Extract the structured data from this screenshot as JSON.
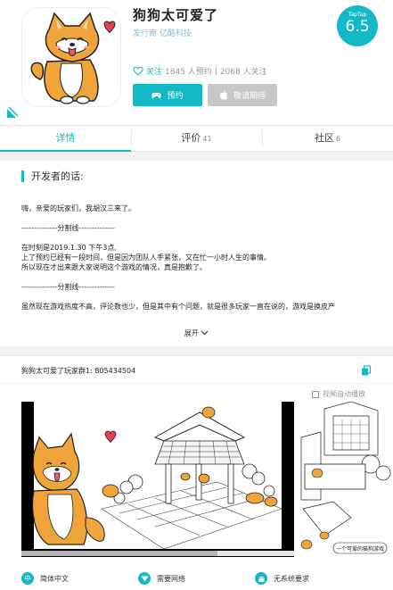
{
  "app": {
    "title": "狗狗太可爱了",
    "publisher_label": "发行商",
    "publisher_name": "亿酷科技",
    "score_brand": "TapTap",
    "score": "6.5"
  },
  "stats": {
    "follow_label": "关注",
    "reservations": "1845 人预约",
    "separator": "|",
    "followers": "2068 人关注"
  },
  "buttons": {
    "reserve": "预约",
    "ios": "敬请期待"
  },
  "tabs": [
    {
      "label": "详情",
      "count": ""
    },
    {
      "label": "评价",
      "count": "41"
    },
    {
      "label": "社区",
      "count": "6"
    }
  ],
  "developer": {
    "title": "开发者的话:",
    "lines": [
      "嗨，亲爱的玩家们，我胡汉三来了。",
      "--------------分割线--------------",
      "在时刻是2019.1.30 下午3点,",
      "上了预约已经有一段时间，但是因为团队人手紧张，又在忙一小时人生的事情。",
      "所以现在才出来跟大家说明这个游戏的情况，真是抱歉了。",
      "--------------分割线--------------",
      "虽然现在游戏热度不高，评论数也少，但是其中有个问题，就是很多玩家一直在说的，游戏是换皮产"
    ],
    "expand_label": "展开"
  },
  "group": {
    "text": "狗狗太可爱了玩家群1:  805434504"
  },
  "media": {
    "autoplay_label": "视频自动播放",
    "shot2_caption": "一个可爱的猫狗游戏"
  },
  "features": [
    {
      "icon": "中",
      "label": "简体中文"
    },
    {
      "icon": "",
      "label": "需要网络"
    },
    {
      "icon": "",
      "label": "无系统要求"
    }
  ],
  "colors": {
    "accent": "#14b9c8",
    "disabled": "#c8c8c8",
    "dog_orange": "#f0a53a"
  }
}
